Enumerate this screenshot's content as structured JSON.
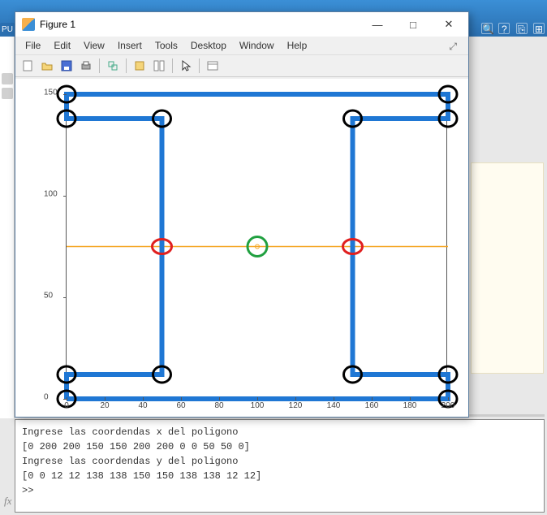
{
  "window": {
    "title": "Figure 1",
    "min_label": "—",
    "max_label": "□",
    "close_label": "✕"
  },
  "menu": {
    "file": "File",
    "edit": "Edit",
    "view": "View",
    "insert": "Insert",
    "tools": "Tools",
    "desktop": "Desktop",
    "window": "Window",
    "help": "Help",
    "dock": "⤢"
  },
  "bg_toolbar": {
    "a": "?",
    "b": "⎘",
    "c": "⊞"
  },
  "toolbar_icons": [
    "new-icon",
    "open-icon",
    "save-icon",
    "print-icon",
    "sep",
    "link-icon",
    "sep",
    "prefs-icon",
    "layout-icon",
    "sep",
    "pointer-icon",
    "sep",
    "panel-icon"
  ],
  "chart_data": {
    "type": "line",
    "xlim": [
      0,
      200
    ],
    "ylim": [
      0,
      150
    ],
    "xticks": [
      0,
      20,
      40,
      60,
      80,
      100,
      120,
      140,
      160,
      180,
      200
    ],
    "yticks": [
      0,
      50,
      100,
      150
    ],
    "polygon": {
      "x": [
        0,
        200,
        200,
        150,
        150,
        200,
        200,
        0,
        0,
        50,
        50,
        0
      ],
      "y": [
        0,
        0,
        12,
        12,
        138,
        138,
        150,
        150,
        138,
        138,
        12,
        12
      ],
      "color": "#1f77d4",
      "width": 6
    },
    "ray": {
      "y": 75,
      "x0": 0,
      "x1": 200,
      "color": "#f5a623",
      "width": 1.5
    },
    "black_circles": [
      {
        "x": 0,
        "y": 150
      },
      {
        "x": 200,
        "y": 150
      },
      {
        "x": 0,
        "y": 138
      },
      {
        "x": 50,
        "y": 138
      },
      {
        "x": 150,
        "y": 138
      },
      {
        "x": 200,
        "y": 138
      },
      {
        "x": 0,
        "y": 12
      },
      {
        "x": 50,
        "y": 12
      },
      {
        "x": 150,
        "y": 12
      },
      {
        "x": 200,
        "y": 12
      },
      {
        "x": 0,
        "y": 0
      },
      {
        "x": 200,
        "y": 0
      }
    ],
    "red_circles": [
      {
        "x": 50,
        "y": 75
      },
      {
        "x": 150,
        "y": 75
      }
    ],
    "green_circle": {
      "x": 100,
      "y": 75
    },
    "green_center_dot": {
      "x": 100,
      "y": 75
    }
  },
  "console": {
    "line1": "Ingrese las coordendas x del poligono",
    "line2": "[0 200 200 150 150 200 200 0 0 50 50 0]",
    "line3": "Ingrese las coordendas y del poligono",
    "line4": "[0 0 12 12 138 138 150 150 138 138 12 12]",
    "prompt": ">> ",
    "fx": "fx"
  }
}
